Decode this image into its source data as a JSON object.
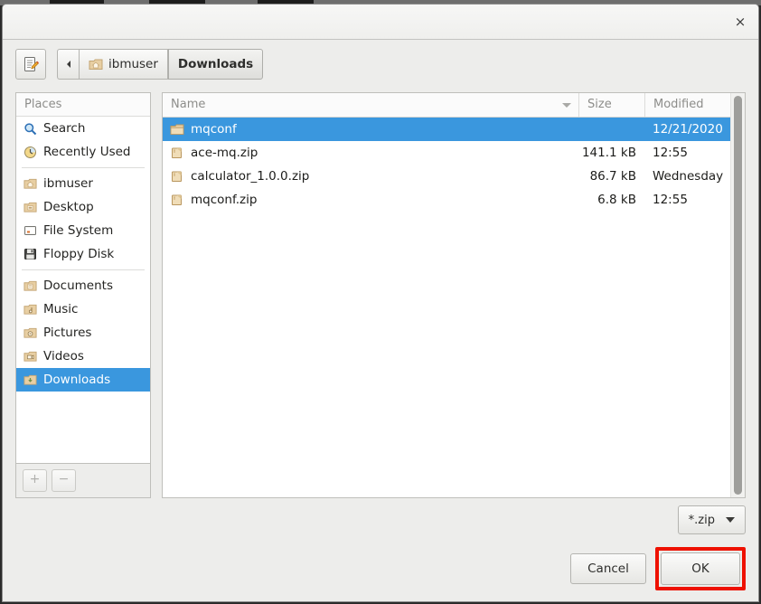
{
  "window": {
    "title": "",
    "close_label": "×"
  },
  "toolbar": {
    "location_toggle_icon": "document-pencil-icon",
    "back_label": "◂",
    "breadcrumbs": [
      {
        "label": "ibmuser",
        "icon": "home-folder-icon",
        "active": false
      },
      {
        "label": "Downloads",
        "icon": "",
        "active": true
      }
    ]
  },
  "places": {
    "header": "Places",
    "items": [
      {
        "label": "Search",
        "icon": "search-icon",
        "selected": false,
        "separator_after": false
      },
      {
        "label": "Recently Used",
        "icon": "recent-clock-icon",
        "selected": false,
        "separator_after": true
      },
      {
        "label": "ibmuser",
        "icon": "home-folder-icon",
        "selected": false,
        "separator_after": false
      },
      {
        "label": "Desktop",
        "icon": "desktop-folder-icon",
        "selected": false,
        "separator_after": false
      },
      {
        "label": "File System",
        "icon": "drive-icon",
        "selected": false,
        "separator_after": false
      },
      {
        "label": "Floppy Disk",
        "icon": "floppy-icon",
        "selected": false,
        "separator_after": true
      },
      {
        "label": "Documents",
        "icon": "documents-folder-icon",
        "selected": false,
        "separator_after": false
      },
      {
        "label": "Music",
        "icon": "music-folder-icon",
        "selected": false,
        "separator_after": false
      },
      {
        "label": "Pictures",
        "icon": "pictures-folder-icon",
        "selected": false,
        "separator_after": false
      },
      {
        "label": "Videos",
        "icon": "videos-folder-icon",
        "selected": false,
        "separator_after": false
      },
      {
        "label": "Downloads",
        "icon": "downloads-folder-icon",
        "selected": true,
        "separator_after": false
      }
    ],
    "add_label": "+",
    "remove_label": "−"
  },
  "file_list": {
    "columns": [
      {
        "key": "name",
        "label": "Name",
        "sorted": true,
        "sort_direction": "descending"
      },
      {
        "key": "size",
        "label": "Size",
        "sorted": false
      },
      {
        "key": "modified",
        "label": "Modified",
        "sorted": false
      }
    ],
    "rows": [
      {
        "name": "mqconf",
        "size": "",
        "modified": "12/21/2020",
        "icon": "folder-icon",
        "selected": true
      },
      {
        "name": "ace-mq.zip",
        "size": "141.1 kB",
        "modified": "12:55",
        "icon": "archive-icon",
        "selected": false
      },
      {
        "name": "calculator_1.0.0.zip",
        "size": "86.7 kB",
        "modified": "Wednesday",
        "icon": "archive-icon",
        "selected": false
      },
      {
        "name": "mqconf.zip",
        "size": "6.8 kB",
        "modified": "12:55",
        "icon": "archive-icon",
        "selected": false
      }
    ]
  },
  "footer": {
    "filter_value": "*.zip",
    "cancel_label": "Cancel",
    "ok_label": "OK"
  },
  "colors": {
    "selection_blue": "#3a97de",
    "highlight_red": "#ee1100",
    "window_bg": "#ededeb",
    "list_bg": "#ffffff"
  }
}
